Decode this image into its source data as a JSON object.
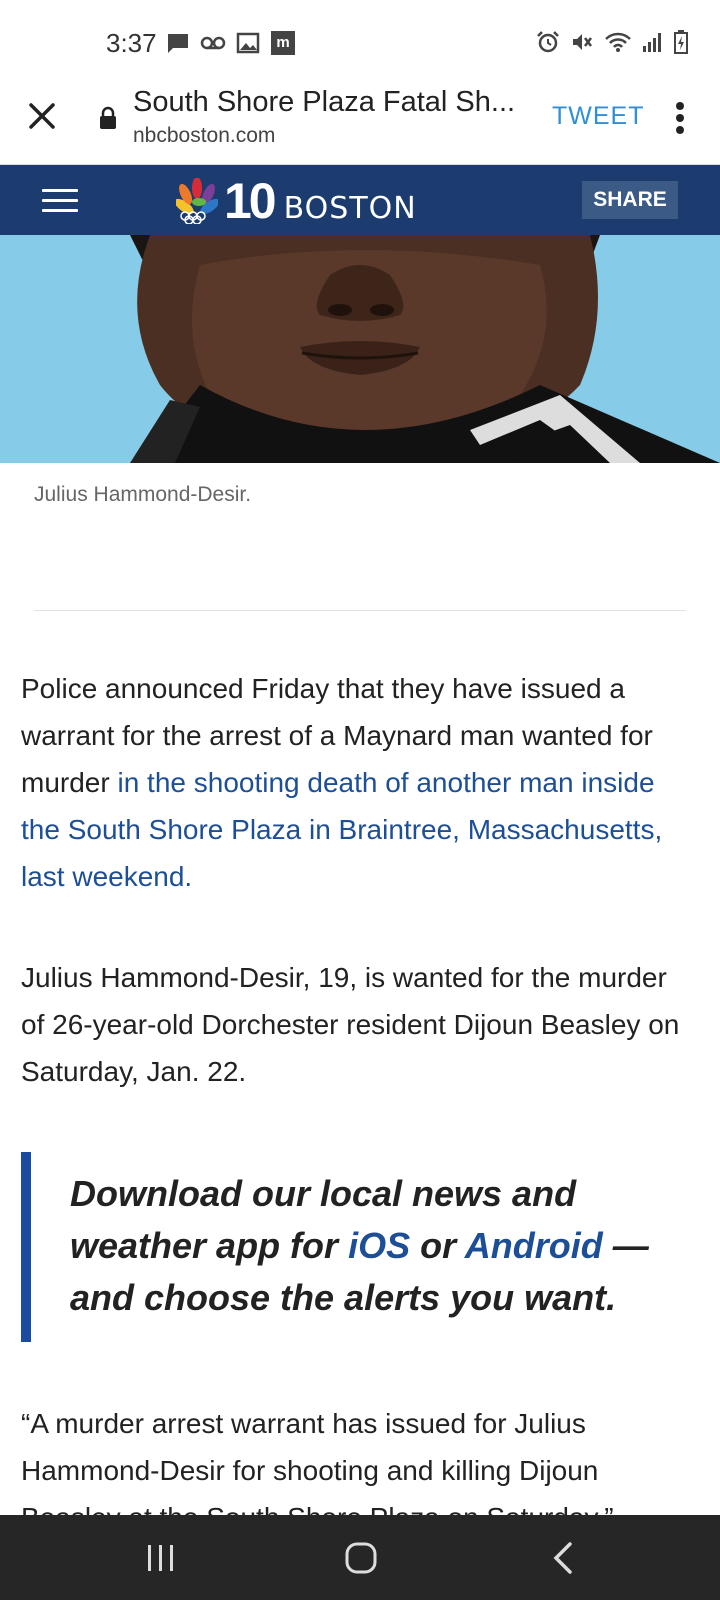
{
  "status_bar": {
    "time": "3:37",
    "left_icons": [
      "message-icon",
      "voicemail-icon",
      "gallery-icon",
      "m-app-icon"
    ],
    "right_icons": [
      "alarm-icon",
      "mute-icon",
      "wifi-icon",
      "signal-icon",
      "battery-icon"
    ]
  },
  "browser": {
    "title": "South Shore Plaza Fatal Sh...",
    "domain": "nbcboston.com",
    "tweet_label": "TWEET"
  },
  "site_header": {
    "logo_number": "10",
    "logo_city": "BOSTON",
    "share_label": "SHARE",
    "header_color": "#1c3b6e"
  },
  "article": {
    "caption": "Julius Hammond-Desir.",
    "p1_text": "Police announced Friday that they have issued a warrant for the arrest of a Maynard man wanted for murder ",
    "p1_link": "in the shooting death of another man inside the South Shore Plaza in Braintree, Massachusetts, last weekend.",
    "p2_text": "Julius Hammond-Desir, 19, is wanted for the murder of 26-year-old Dorchester resident Dijoun Beasley on Saturday, Jan. 22.",
    "promo": {
      "text_a": "Download our local news and weather app for ",
      "link_ios": "iOS",
      "text_b": " or ",
      "link_android": "Android",
      "text_c": " — and choose the alerts you want."
    },
    "p3_text": "“A murder arrest warrant has issued for Julius Hammond-Desir for shooting and killing Dijoun Beasley at the South Shore Plaza on Saturday,”"
  },
  "colors": {
    "link": "#1d4f96",
    "tweet": "#2f8fd6",
    "promo_border": "#1c4aa0"
  },
  "nav_bar": {
    "buttons": [
      "recent-apps-icon",
      "home-icon",
      "back-icon"
    ]
  }
}
